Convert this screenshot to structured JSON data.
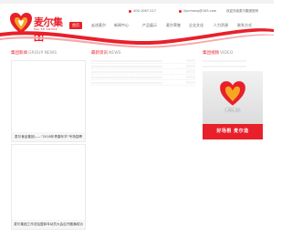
{
  "brand": {
    "name": "麦尔集团",
    "tagline": "MAI ER GROUP",
    "color": "#e8202a"
  },
  "contact": {
    "phone": "400-1067-217",
    "email": "lijunmeng@163.com",
    "site": "欢迎光临麦尔集团官网"
  },
  "nav": {
    "items": [
      {
        "label": "首页",
        "active": true
      },
      {
        "label": "走进麦尔"
      },
      {
        "label": "新闻中心"
      },
      {
        "label": "产品展示"
      },
      {
        "label": "麦尔荣誉"
      },
      {
        "label": "企业文化"
      },
      {
        "label": "人力资源"
      },
      {
        "label": "联系方式"
      }
    ]
  },
  "sections": {
    "group": {
      "title": "集团新闻",
      "en": "GROUP NEWS"
    },
    "news": {
      "title": "最新资讯",
      "en": "NEWS"
    },
    "video": {
      "title": "集团视频",
      "en": "VIDEO"
    }
  },
  "group_news": [
    {
      "caption": "麦尔食品集团——“2018年青春年华”专场招聘"
    },
    {
      "caption": "麦尔集团工作总结暨新年动员大会召开圆满成功"
    }
  ],
  "video": {
    "logo_text": "麦尔食品",
    "banner": "好场根 麦尔造",
    "icon": "play-icon"
  }
}
